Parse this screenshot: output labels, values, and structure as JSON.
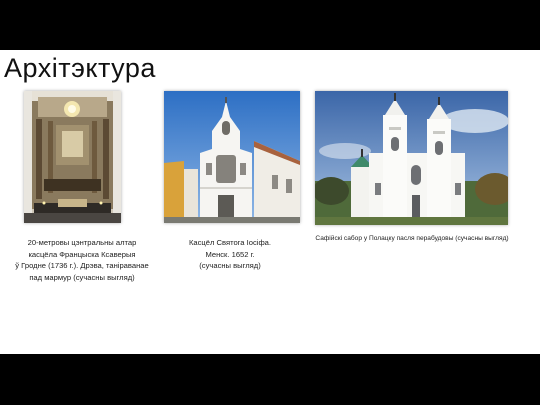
{
  "slide": {
    "title": "Архітэктура",
    "images": [
      {
        "icon": "altar-photo",
        "caption": [
          "20-метровы цэнтральны алтар",
          "касцёла Францыска Ксаверыя",
          "ў Гродне (1736 г.). Дрэва, таніраванае",
          "пад мармур (сучасны выгляд)"
        ]
      },
      {
        "icon": "church-photo",
        "caption": [
          "Касцёл Святога Іосіфа.",
          "Менск. 1652 г.",
          "(сучасны выгляд)"
        ]
      },
      {
        "icon": "cathedral-photo",
        "caption": [
          "Сафійскі сабор у Полацку пасля перабудовы (сучасны выгляд)"
        ]
      }
    ]
  }
}
